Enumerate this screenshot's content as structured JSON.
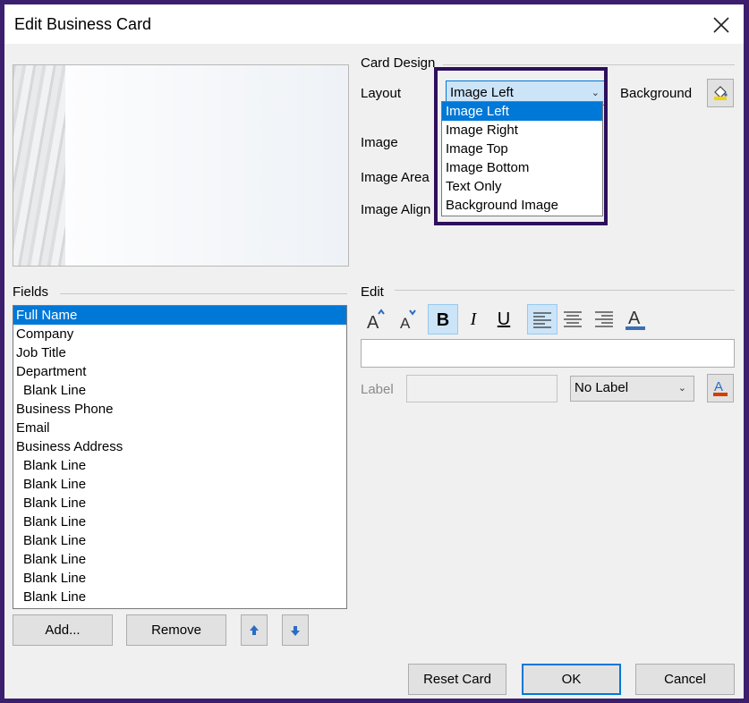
{
  "window": {
    "title": "Edit Business Card"
  },
  "card_design": {
    "group_label": "Card Design",
    "layout_label": "Layout",
    "layout_value": "Image Left",
    "background_label": "Background",
    "image_label": "Image",
    "image_area_label": "Image Area",
    "image_align_label": "Image Align",
    "layout_options": [
      "Image Left",
      "Image Right",
      "Image Top",
      "Image Bottom",
      "Text Only",
      "Background Image"
    ],
    "selected_option_index": 0
  },
  "fields": {
    "group_label": "Fields",
    "items": [
      {
        "label": "Full Name",
        "indent": false,
        "selected": true
      },
      {
        "label": "Company",
        "indent": false
      },
      {
        "label": "Job Title",
        "indent": false
      },
      {
        "label": "Department",
        "indent": false
      },
      {
        "label": "Blank Line",
        "indent": true
      },
      {
        "label": "Business Phone",
        "indent": false
      },
      {
        "label": "Email",
        "indent": false
      },
      {
        "label": "Business Address",
        "indent": false
      },
      {
        "label": "Blank Line",
        "indent": true
      },
      {
        "label": "Blank Line",
        "indent": true
      },
      {
        "label": "Blank Line",
        "indent": true
      },
      {
        "label": "Blank Line",
        "indent": true
      },
      {
        "label": "Blank Line",
        "indent": true
      },
      {
        "label": "Blank Line",
        "indent": true
      },
      {
        "label": "Blank Line",
        "indent": true
      },
      {
        "label": "Blank Line",
        "indent": true
      }
    ],
    "add_label": "Add...",
    "remove_label": "Remove"
  },
  "edit": {
    "group_label": "Edit",
    "text_value": "",
    "label_caption": "Label",
    "label_value": "",
    "label_position": "No Label",
    "bold_active": true,
    "align_left_active": true
  },
  "footer": {
    "reset_label": "Reset Card",
    "ok_label": "OK",
    "cancel_label": "Cancel"
  },
  "colors": {
    "accent": "#0078d7",
    "highlight_frame": "#2d0f5c",
    "font_color_bar": "#3b6fb6",
    "label_color_bar": "#d83b01"
  }
}
